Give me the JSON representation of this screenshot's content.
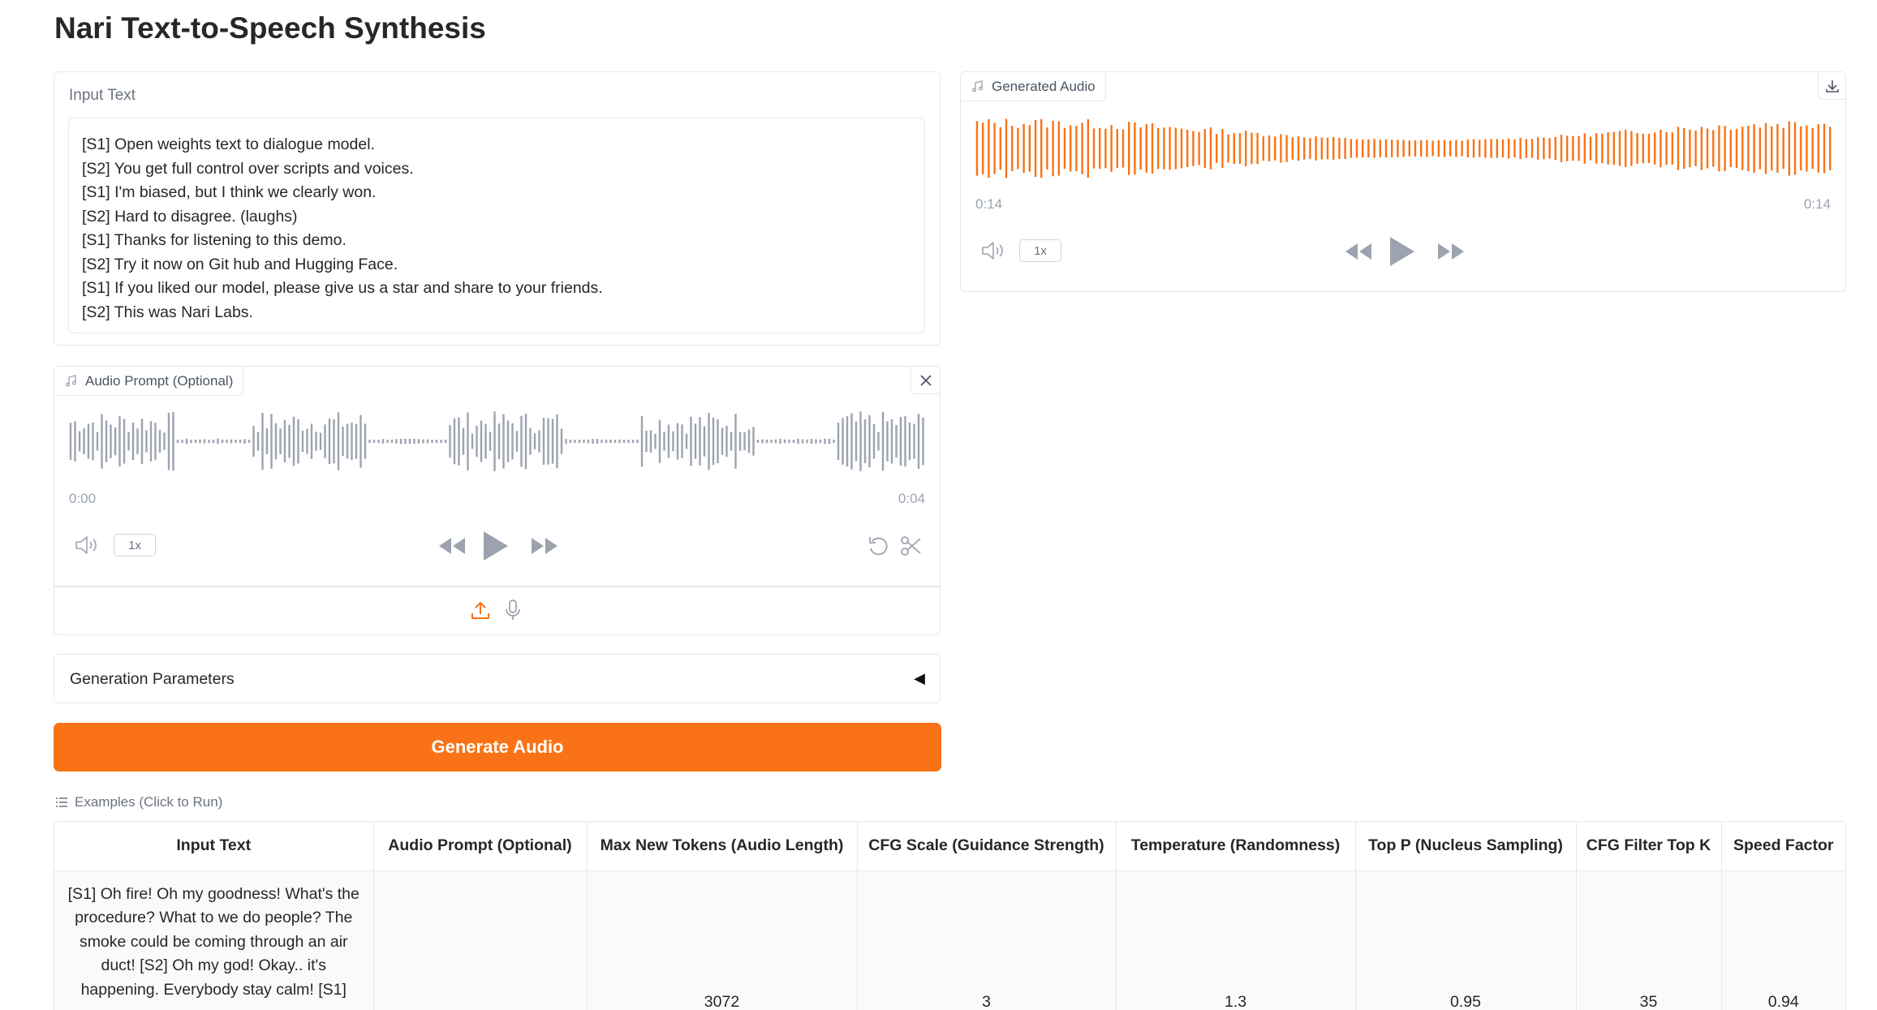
{
  "title": "Nari Text-to-Speech Synthesis",
  "input_text": {
    "label": "Input Text",
    "lines": [
      "[S1] Open weights text to dialogue model.",
      "[S2] You get full control over scripts and voices.",
      "[S1] I'm biased, but I think we clearly won.",
      "[S2] Hard to disagree. (laughs)",
      "[S1] Thanks for listening to this demo.",
      "[S2] Try it now on Git hub and Hugging Face.",
      "[S1] If you liked our model, please give us a star and share to your friends.",
      "[S2] This was Nari Labs."
    ]
  },
  "audio_prompt": {
    "label": "Audio Prompt (Optional)",
    "time_start": "0:00",
    "time_end": "0:04",
    "rate": "1x",
    "wave_color": "#9ca3af"
  },
  "params": {
    "label": "Generation Parameters",
    "caret": "◀"
  },
  "generate_button": {
    "label": "Generate Audio",
    "color": "#f97316"
  },
  "generated_audio": {
    "label": "Generated Audio",
    "time_start": "0:14",
    "time_end": "0:14",
    "rate": "1x",
    "wave_color": "#f97316"
  },
  "examples": {
    "title": "Examples (Click to Run)",
    "headers": [
      "Input Text",
      "Audio Prompt (Optional)",
      "Max New Tokens (Audio Length)",
      "CFG Scale (Guidance Strength)",
      "Temperature (Randomness)",
      "Top P (Nucleus Sampling)",
      "CFG Filter Top K",
      "Speed Factor"
    ],
    "rows": [
      {
        "input_text": "[S1] Oh fire! Oh my goodness! What's the procedure? What to we do people? The smoke could be coming through an air duct! [S2] Oh my god! Okay.. it's happening. Everybody stay calm! [S1]",
        "audio_prompt": "",
        "max_new_tokens": "3072",
        "cfg_scale": "3",
        "temperature": "1.3",
        "top_p": "0.95",
        "cfg_filter_top_k": "35",
        "speed_factor": "0.94"
      }
    ]
  }
}
